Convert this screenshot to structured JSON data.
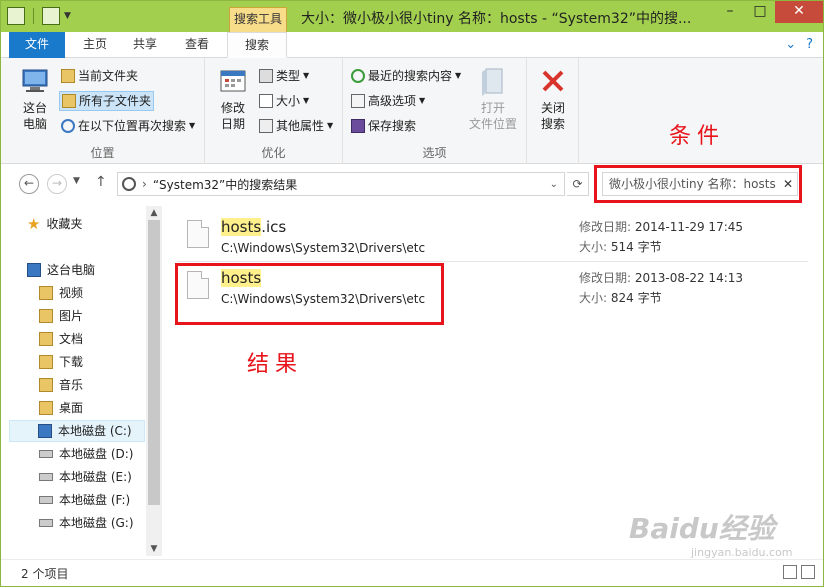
{
  "window": {
    "title": "大小：微小极小很小tiny 名称：hosts - “System32”中的搜...",
    "contextual_tab": "搜索工具"
  },
  "tabs": [
    {
      "label": "文件"
    },
    {
      "label": "主页"
    },
    {
      "label": "共享"
    },
    {
      "label": "查看"
    },
    {
      "label": "搜索"
    }
  ],
  "ribbon": {
    "location": {
      "label": "位置",
      "this_pc": "这台\n电脑",
      "current_folder": "当前文件夹",
      "all_subfolders": "所有子文件夹",
      "search_again_in": "在以下位置再次搜索"
    },
    "refine": {
      "label": "优化",
      "date_modified": "修改\n日期",
      "kind": "类型",
      "size": "大小",
      "other_properties": "其他属性"
    },
    "options": {
      "label": "选项",
      "recent_searches": "最近的搜索内容",
      "advanced_options": "高级选项",
      "save_search": "保存搜索",
      "open_file_location": "打开\n文件位置",
      "close_search": "关闭\n搜索"
    }
  },
  "address": {
    "path": "“System32”中的搜索结果",
    "search_query": "微小极小很小tiny 名称：hosts"
  },
  "annotations": {
    "conditions": "条件",
    "results": "结果"
  },
  "nav": {
    "favorites": "收藏夹",
    "this_pc": "这台电脑",
    "items": [
      {
        "label": "视频"
      },
      {
        "label": "图片"
      },
      {
        "label": "文档"
      },
      {
        "label": "下载"
      },
      {
        "label": "音乐"
      },
      {
        "label": "桌面"
      },
      {
        "label": "本地磁盘 (C:)"
      },
      {
        "label": "本地磁盘 (D:)"
      },
      {
        "label": "本地磁盘 (E:)"
      },
      {
        "label": "本地磁盘 (F:)"
      },
      {
        "label": "本地磁盘 (G:)"
      }
    ]
  },
  "results": [
    {
      "name_highlight": "hosts",
      "name_rest": ".ics",
      "path": "C:\\Windows\\System32\\Drivers\\etc",
      "modified_label": "修改日期:",
      "modified": "2014-11-29 17:45",
      "size_label": "大小:",
      "size": "514 字节"
    },
    {
      "name_highlight": "hosts",
      "name_rest": "",
      "path": "C:\\Windows\\System32\\Drivers\\etc",
      "modified_label": "修改日期:",
      "modified": "2013-08-22 14:13",
      "size_label": "大小:",
      "size": "824 字节"
    }
  ],
  "status": {
    "count": "2 个项目"
  },
  "watermark": {
    "brand": "Baidu经验",
    "url": "jingyan.baidu.com"
  },
  "colors": {
    "titlebar": "#a2d04e",
    "file_tab": "#1979ca",
    "annotation_red": "#e8141b",
    "highlight": "#fff08c"
  }
}
